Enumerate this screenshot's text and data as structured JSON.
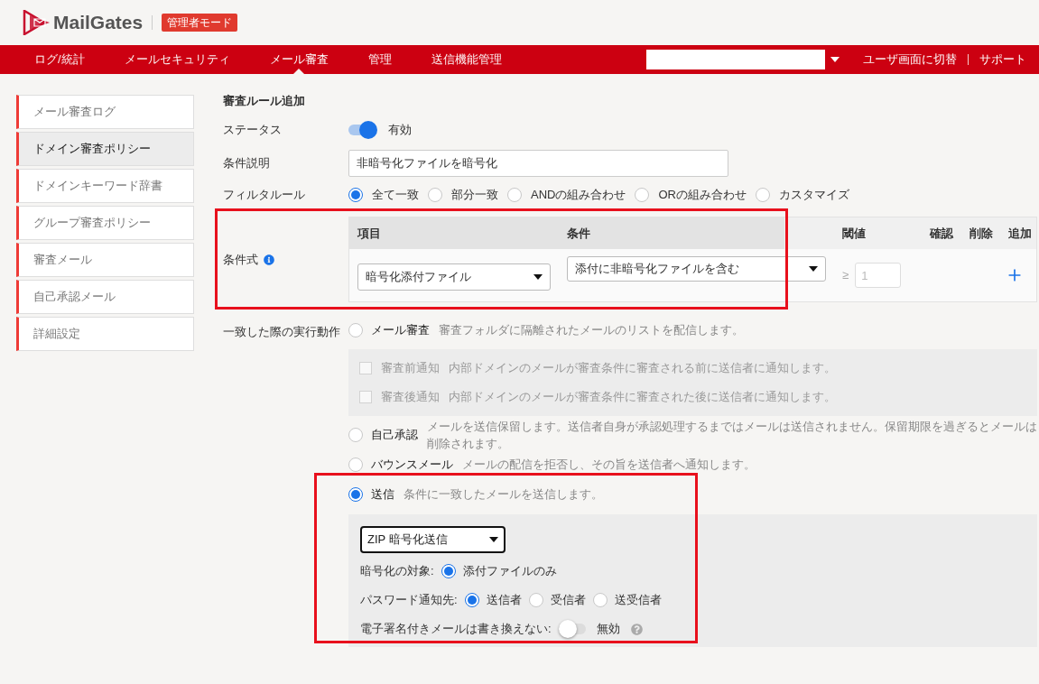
{
  "app": {
    "logo": "MailGates",
    "mode_badge": "管理者モード"
  },
  "nav": {
    "items": [
      {
        "label": "ログ/統計",
        "selected": false
      },
      {
        "label": "メールセキュリティ",
        "selected": false
      },
      {
        "label": "メール審査",
        "selected": true
      },
      {
        "label": "管理",
        "selected": false
      },
      {
        "label": "送信機能管理",
        "selected": false
      }
    ],
    "links": [
      "ユーザ画面に切替",
      "サポート"
    ]
  },
  "sidebar": {
    "items": [
      {
        "label": "メール審査ログ",
        "selected": false
      },
      {
        "label": "ドメイン審査ポリシー",
        "selected": true
      },
      {
        "label": "ドメインキーワード辞書",
        "selected": false
      },
      {
        "label": "グループ審査ポリシー",
        "selected": false
      },
      {
        "label": "審査メール",
        "selected": false
      },
      {
        "label": "自己承認メール",
        "selected": false
      },
      {
        "label": "詳細設定",
        "selected": false
      }
    ]
  },
  "form": {
    "title": "審査ルール追加",
    "status": {
      "label": "ステータス",
      "on": true,
      "text": "有効"
    },
    "description": {
      "label": "条件説明",
      "value": "非暗号化ファイルを暗号化"
    },
    "filter_rule": {
      "label": "フィルタルール",
      "options": [
        {
          "label": "全て一致",
          "selected": true
        },
        {
          "label": "部分一致",
          "selected": false
        },
        {
          "label": "ANDの組み合わせ",
          "selected": false
        },
        {
          "label": "ORの組み合わせ",
          "selected": false
        },
        {
          "label": "カスタマイズ",
          "selected": false
        }
      ]
    },
    "conditions": {
      "label": "条件式",
      "highlighted": true,
      "columns": [
        "項目",
        "条件",
        "閾値",
        "確認",
        "削除",
        "追加"
      ],
      "rows": [
        {
          "item": "暗号化添付ファイル",
          "condition": "添付に非暗号化ファイルを含む",
          "threshold_sign": "≥",
          "threshold": "1",
          "threshold_disabled": true
        }
      ]
    },
    "actions": {
      "label": "一致した際の実行動作",
      "options": [
        {
          "label": "メール審査",
          "description": "審査フォルダに隔離されたメールのリストを配信します。",
          "selected": false,
          "checkboxes": [
            {
              "label": "審査前通知",
              "description": "内部ドメインのメールが審査条件に審査される前に送信者に通知します。",
              "checked": false,
              "disabled": true
            },
            {
              "label": "審査後通知",
              "description": "内部ドメインのメールが審査条件に審査された後に送信者に通知します。",
              "checked": false,
              "disabled": true
            }
          ]
        },
        {
          "label": "自己承認",
          "description": "メールを送信保留します。送信者自身が承認処理するまではメールは送信されません。保留期限を過ぎるとメールは削除されます。",
          "selected": false
        },
        {
          "label": "バウンスメール",
          "description": "メールの配信を拒否し、その旨を送信者へ通知します。",
          "selected": false
        },
        {
          "label": "送信",
          "description": "条件に一致したメールを送信します。",
          "selected": true,
          "highlighted": true,
          "send_settings": {
            "method": "ZIP 暗号化送信",
            "groups": [
              {
                "label": "暗号化の対象:",
                "options": [
                  {
                    "label": "添付ファイルのみ",
                    "selected": true
                  }
                ]
              },
              {
                "label": "パスワード通知先:",
                "options": [
                  {
                    "label": "送信者",
                    "selected": true
                  },
                  {
                    "label": "受信者",
                    "selected": false
                  },
                  {
                    "label": "送受信者",
                    "selected": false
                  }
                ]
              }
            ],
            "signed_mail": {
              "label": "電子署名付きメールは書き換えない:",
              "on": false,
              "text": "無効"
            }
          }
        }
      ]
    }
  }
}
